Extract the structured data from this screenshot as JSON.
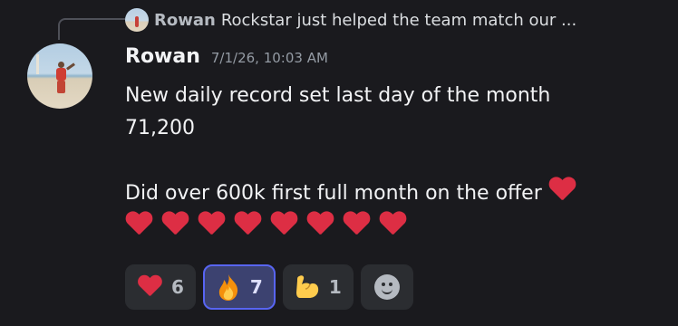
{
  "reply": {
    "author": "Rowan",
    "preview": "Rockstar just helped the team match our ..."
  },
  "message": {
    "author": "Rowan",
    "timestamp": "7/1/26, 10:03 AM",
    "line1": "New daily record set last day of the month",
    "line2": "71,200",
    "line3": "Did over 600k first full month on the offer",
    "trailing_emoji": "red-heart",
    "heart_row_count": 8
  },
  "reactions": [
    {
      "emoji": "red-heart",
      "count": "6",
      "selected": false
    },
    {
      "emoji": "fire",
      "count": "7",
      "selected": true
    },
    {
      "emoji": "flexed-biceps",
      "count": "1",
      "selected": false
    }
  ],
  "add_reaction_icon": "smiley-icon",
  "colors": {
    "background": "#1a1a1e",
    "accent": "#5865f2",
    "heart": "#dd2e44"
  }
}
